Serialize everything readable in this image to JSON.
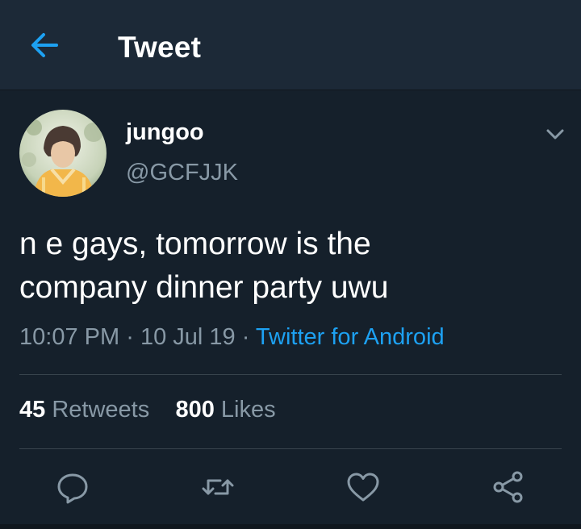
{
  "header": {
    "title": "Tweet",
    "back_icon": "arrow-left-icon"
  },
  "tweet": {
    "display_name": "jungoo",
    "handle": "@GCFJJK",
    "text_line1": "n e gays, tomorrow is the",
    "text_line2": "company dinner party uwu",
    "time": "10:07 PM",
    "date": "10 Jul 19",
    "separator": "·",
    "source": "Twitter for Android"
  },
  "stats": {
    "retweets_count": "45",
    "retweets_label": "Retweets",
    "likes_count": "800",
    "likes_label": "Likes"
  },
  "actions": [
    "reply-icon",
    "retweet-icon",
    "like-icon",
    "share-icon"
  ],
  "colors": {
    "background": "#15202b",
    "header": "#1c2937",
    "accent": "#1da1f2",
    "secondary_text": "#8899a6",
    "divider": "#38444d"
  }
}
